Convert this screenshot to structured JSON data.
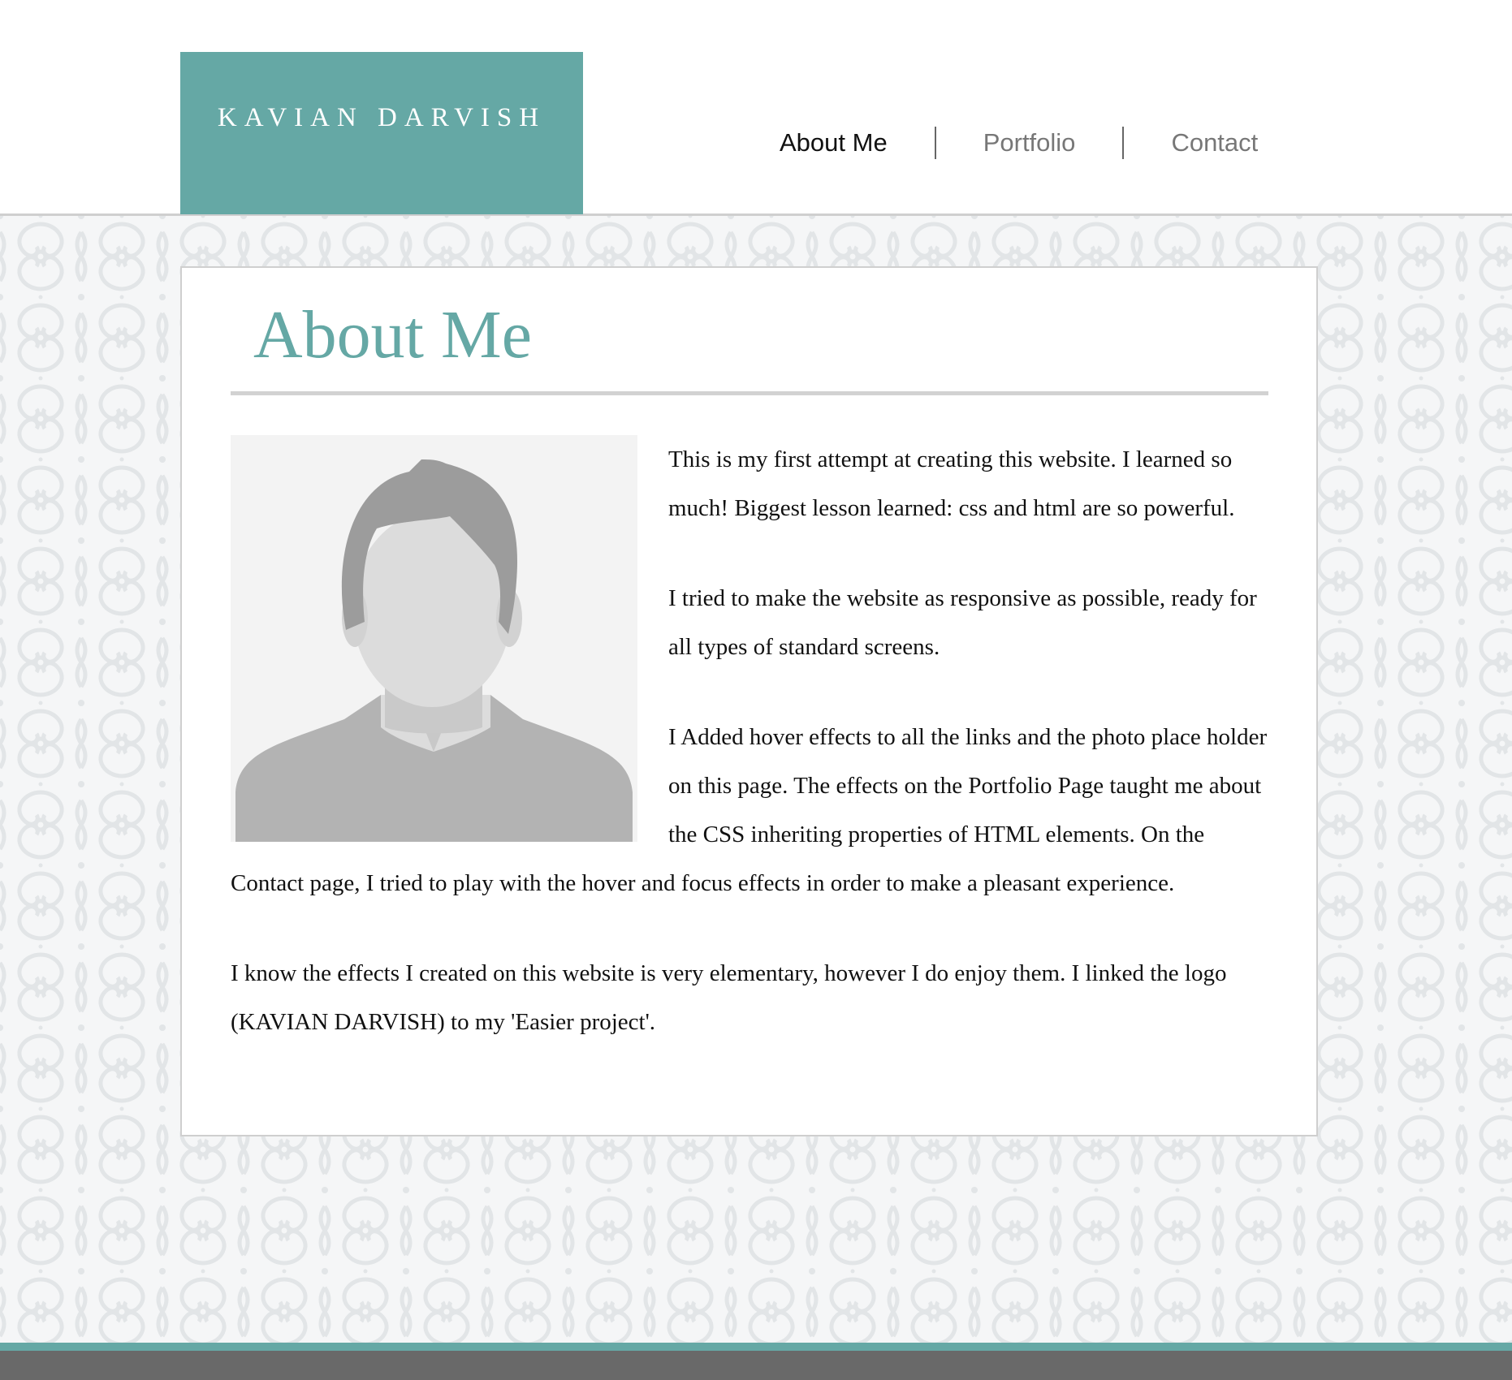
{
  "header": {
    "logo_text": "KAVIAN DARVISH",
    "nav": [
      {
        "label": "About Me",
        "active": true
      },
      {
        "label": "Portfolio",
        "active": false
      },
      {
        "label": "Contact",
        "active": false
      }
    ]
  },
  "main": {
    "title": "About Me",
    "photo_icon": "person-placeholder-icon",
    "paragraphs": [
      "This is my first attempt at creating this website. I learned so much! Biggest lesson learned: css and html are so powerful.",
      "I tried to make the website as responsive as possible, ready for all types of standard screens.",
      "I Added hover effects to all the links and the photo place holder on this page. The effects on the Portfolio Page taught me about the CSS inheriting properties of HTML elements. On the Contact page, I tried to play with the hover and focus effects in order to make a pleasant experience.",
      "I know the effects I created on this website is very elementary, however I do enjoy them. I linked the logo (KAVIAN DARVISH) to my 'Easier project'."
    ]
  },
  "colors": {
    "accent": "#65a8a5",
    "footer": "#696969",
    "rule": "#d2d2d2"
  }
}
